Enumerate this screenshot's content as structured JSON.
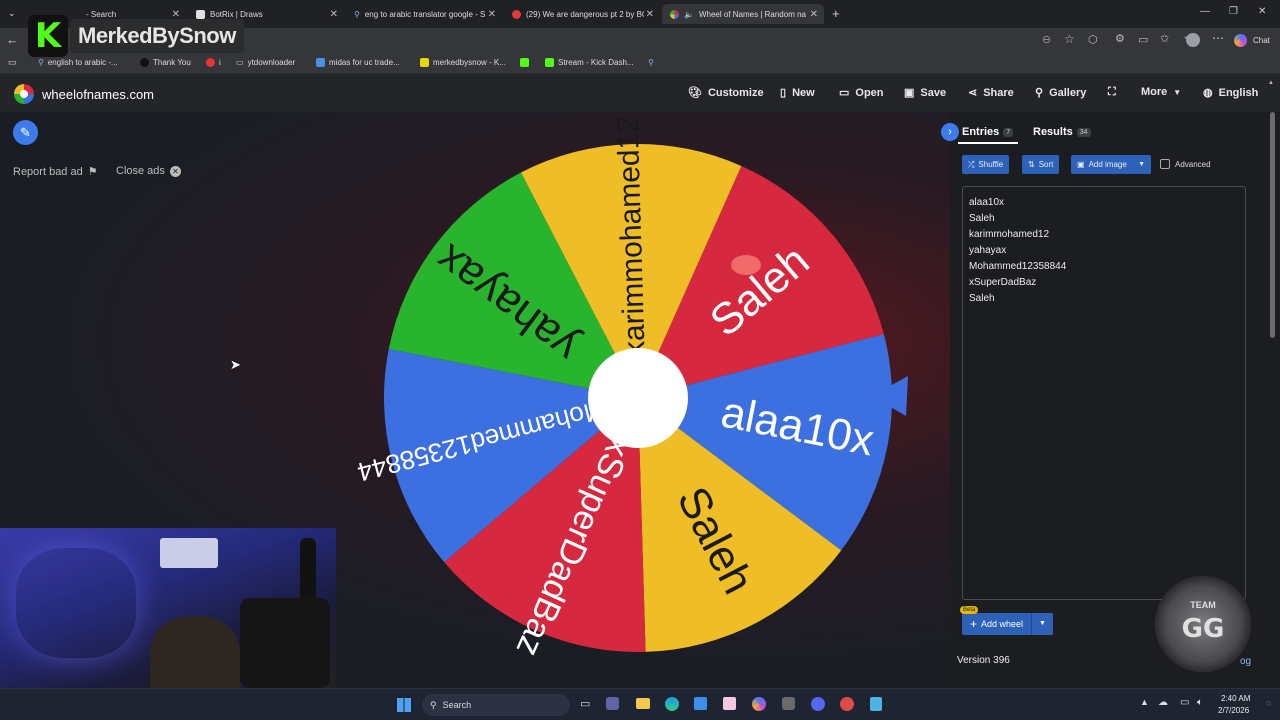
{
  "browser": {
    "tabs": [
      {
        "label": "- Search"
      },
      {
        "label": "BotRix | Draws"
      },
      {
        "label": "eng to arabic translator google - S"
      },
      {
        "label": "(29) We are dangerous pt 2 by BO"
      },
      {
        "label": "Wheel of Names | Random na"
      }
    ],
    "bookmarks": [
      {
        "label": "english to arabic -..."
      },
      {
        "label": "Thank You"
      },
      {
        "label": "i"
      },
      {
        "label": "ytdownloader"
      },
      {
        "label": "midas for uc trade..."
      },
      {
        "label": "merkedbysnow - K..."
      },
      {
        "label": "Stream - Kick Dash..."
      }
    ],
    "chat_label": "Chat"
  },
  "overlay": {
    "logo_letter": "K",
    "logo_text": "MerkedBySnow"
  },
  "site": {
    "name": "wheelofnames.com",
    "nav": {
      "customize": "Customize",
      "new": "New",
      "open": "Open",
      "save": "Save",
      "share": "Share",
      "gallery": "Gallery",
      "more": "More",
      "language": "English"
    }
  },
  "ads": {
    "report": "Report bad ad",
    "close": "Close ads"
  },
  "wheel": {
    "segments": [
      {
        "label": "Saleh",
        "color": "#d6283e"
      },
      {
        "label": "alaa10x",
        "color": "#3c6fe0"
      },
      {
        "label": "Saleh",
        "color": "#efbd26"
      },
      {
        "label": "xSuperDadBaz",
        "color": "#d6283e"
      },
      {
        "label": "Mohammed12358844",
        "color": "#3c6fe0"
      },
      {
        "label": "yahayax",
        "color": "#28b42c"
      },
      {
        "label": "karimmohamed12",
        "color": "#efbd26"
      }
    ]
  },
  "panel": {
    "entries_tab": "Entries",
    "entries_count": "7",
    "results_tab": "Results",
    "results_count": "34",
    "shuffle": "Shuffle",
    "sort": "Sort",
    "add_image": "Add image",
    "advanced": "Advanced",
    "entries": [
      "alaa10x",
      "Saleh",
      "karimmohamed12",
      "yahayax",
      "Mohammed12358844",
      "xSuperDadBaz",
      "Saleh"
    ],
    "beta": "Beta",
    "add_wheel": "Add wheel",
    "version": "Version 396",
    "changelog_fragment": "og"
  },
  "badge": {
    "text": "GG",
    "ring_text": "TEAM"
  },
  "taskbar": {
    "search": "Search",
    "time": "2:40 AM",
    "date": "2/7/2026"
  },
  "colors": {
    "accent": "#3d7bea",
    "button": "#2e61b8",
    "red": "#d6283e",
    "blue": "#3c6fe0",
    "yellow": "#efbd26",
    "green": "#28b42c"
  }
}
